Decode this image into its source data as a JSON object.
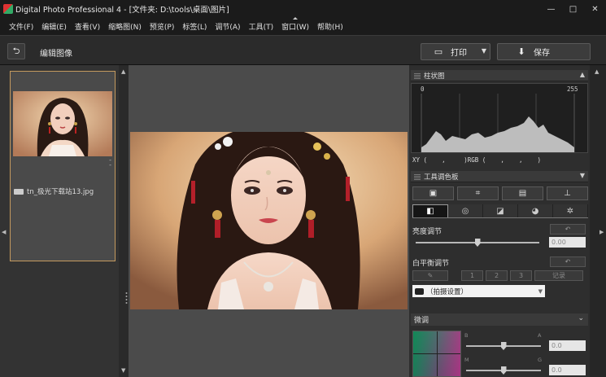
{
  "window": {
    "title": "Digital Photo Professional 4 - [文件夹: D:\\tools\\桌面\\图片]",
    "minimize_glyph": "—",
    "maximize_glyph": "□",
    "close_glyph": "✕"
  },
  "menu": [
    "文件(F)",
    "编辑(E)",
    "查看(V)",
    "缩略图(N)",
    "预览(P)",
    "标签(L)",
    "调节(A)",
    "工具(T)",
    "窗口(W)",
    "帮助(H)"
  ],
  "toolbar": {
    "back_glyph": "⮌",
    "title": "编辑图像",
    "print_label": "打印",
    "save_label": "保存"
  },
  "thumbnail": {
    "filename": "tn_极光下载站13.jpg",
    "rating_marks": "-\n-"
  },
  "histogram": {
    "title": "柱状图",
    "min_label": "0",
    "max_label": "255",
    "readout": "XY (    ,     )RGB (    ,    ,    )"
  },
  "tool_palette": {
    "title": "工具调色板",
    "tool_icons": [
      "crop-preset-icon",
      "crop-icon",
      "picture-style-icon",
      "stamp-icon"
    ],
    "tab_icons": [
      "basic-adjust-icon",
      "lens-icon",
      "tone-curve-icon",
      "color-icon",
      "settings-icon"
    ],
    "brightness": {
      "label": "亮度调节",
      "value": "0.00",
      "level": 0.5
    },
    "white_balance": {
      "label": "白平衡调节",
      "buttons": [
        "1",
        "2",
        "3"
      ],
      "register_label": "记录",
      "preset": "（拍摄设置）"
    },
    "fine_tune": {
      "label": "微调",
      "axis_left": "B",
      "axis_right": "A",
      "axis_left2": "M",
      "axis_right2": "G",
      "value1": "0.0",
      "value2": "0.0",
      "level1": 0.5,
      "level2": 0.5
    }
  }
}
